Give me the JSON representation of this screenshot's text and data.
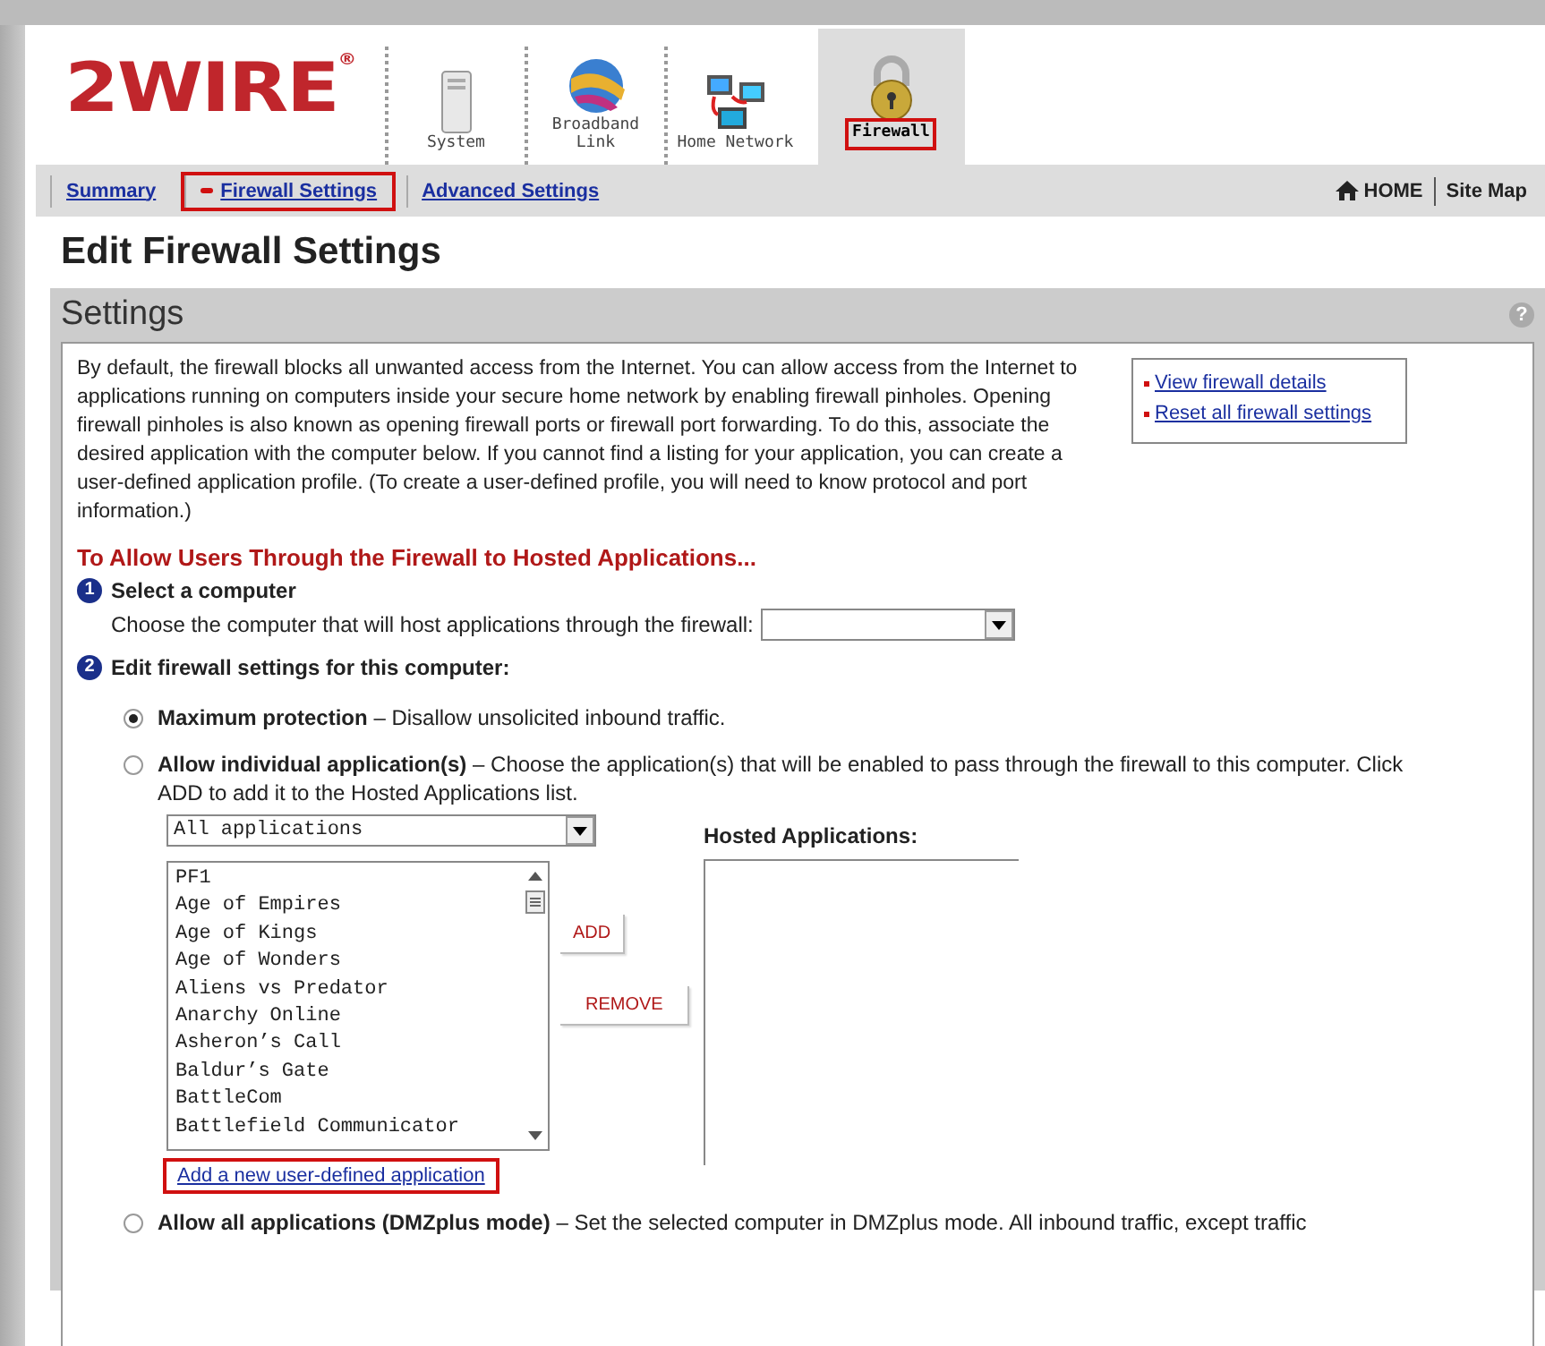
{
  "logo": {
    "text": "2WIRE",
    "mark": "®"
  },
  "tabs": [
    {
      "label": "System",
      "kind": "system",
      "selected": false,
      "highlighted": false
    },
    {
      "label": "Broadband Link",
      "kind": "globe",
      "selected": false,
      "highlighted": false
    },
    {
      "label": "Home Network",
      "kind": "network",
      "selected": false,
      "highlighted": false
    },
    {
      "label": "Firewall",
      "kind": "lock",
      "selected": true,
      "highlighted": true
    }
  ],
  "nav": {
    "links": [
      {
        "label": "Summary",
        "selected": false,
        "highlighted": false
      },
      {
        "label": "Firewall Settings",
        "selected": true,
        "highlighted": true
      },
      {
        "label": "Advanced Settings",
        "selected": false,
        "highlighted": false
      }
    ],
    "home": "HOME",
    "site_map": "Site Map"
  },
  "page_title": "Edit Firewall Settings",
  "panel": {
    "title": "Settings",
    "help": "?",
    "intro": "By default, the firewall blocks all unwanted access from the Internet. You can allow access from the Internet to applications running on computers inside your secure home network by enabling firewall pinholes. Opening firewall pinholes is also known as opening firewall ports or firewall port forwarding. To do this, associate the desired application with the computer below. If you cannot find a listing for your application, you can create a user-defined application profile. (To create a user-defined profile, you will need to know protocol and port information.)",
    "side_links": [
      "View firewall details",
      "Reset all firewall settings"
    ],
    "section_title": "To Allow Users Through the Firewall to Hosted Applications...",
    "steps": [
      {
        "number": "1",
        "title": "Select a computer",
        "text": "Choose the computer that will host applications through the firewall:"
      },
      {
        "number": "2",
        "title": "Edit firewall settings for this computer:"
      }
    ],
    "options": [
      {
        "title": "Maximum protection",
        "text": "– Disallow unsolicited inbound traffic.",
        "selected": true
      },
      {
        "title": "Allow individual application(s)",
        "text": "– Choose the application(s) that will be enabled to pass through the firewall to this computer. Click ADD to add it to the Hosted Applications list.",
        "selected": false
      },
      {
        "title": "Allow all applications (DMZplus mode)",
        "text": "–  Set the selected computer in DMZplus mode. All inbound traffic, except traffic",
        "selected": false
      }
    ],
    "filter": "All applications",
    "applications": [
      "PF1",
      "Age of Empires",
      "Age of Kings",
      "Age of Wonders",
      "Aliens vs Predator",
      "Anarchy Online",
      "Asheron’s Call",
      "Baldur’s Gate",
      "BattleCom",
      "Battlefield Communicator"
    ],
    "add_button": "ADD",
    "remove_button": "REMOVE",
    "hosted_title": "Hosted Applications:",
    "new_app_link": {
      "label": "Add a new user-defined application",
      "highlighted": true
    }
  }
}
